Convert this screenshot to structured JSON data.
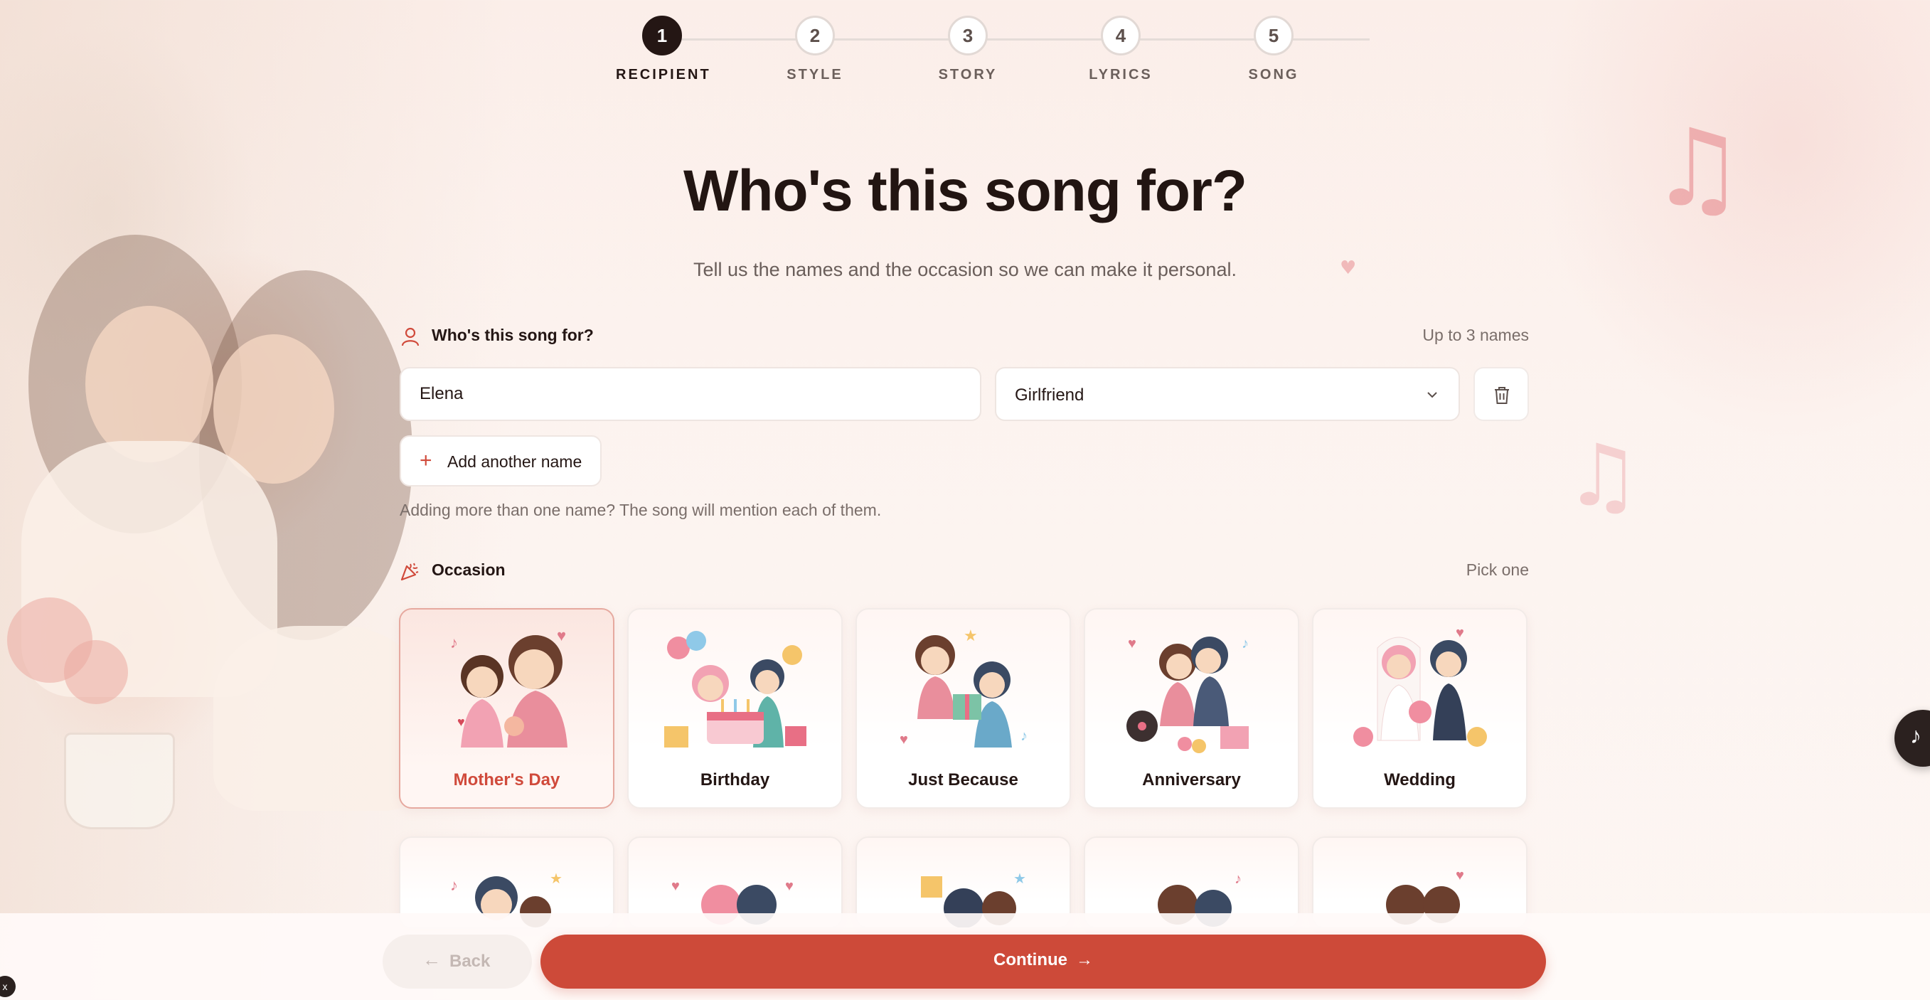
{
  "stepper": {
    "steps": [
      {
        "number": "1",
        "label": "RECIPIENT"
      },
      {
        "number": "2",
        "label": "STYLE"
      },
      {
        "number": "3",
        "label": "STORY"
      },
      {
        "number": "4",
        "label": "LYRICS"
      },
      {
        "number": "5",
        "label": "SONG"
      }
    ],
    "active_step": 1
  },
  "header": {
    "title": "Who's this song for?",
    "subtitle": "Tell us the names and the occasion so we can make it personal."
  },
  "recipients": {
    "section_label": "Who's this song for?",
    "section_hint": "Up to 3 names",
    "name_value": "Elena",
    "relation_value": "Girlfriend",
    "add_label": "Add another name",
    "helper_text": "Adding more than one name? The song will mention each of them."
  },
  "occasion": {
    "section_label": "Occasion",
    "section_hint": "Pick one",
    "selected": "Mother's Day",
    "cards": [
      {
        "label": "Mother's Day",
        "icon": "mother-child-illustration"
      },
      {
        "label": "Birthday",
        "icon": "birthday-cake-illustration"
      },
      {
        "label": "Just Because",
        "icon": "gift-couple-illustration"
      },
      {
        "label": "Anniversary",
        "icon": "couple-kiss-illustration"
      },
      {
        "label": "Wedding",
        "icon": "bride-groom-illustration"
      }
    ]
  },
  "footer": {
    "back_label": "Back",
    "continue_label": "Continue"
  },
  "colors": {
    "accent": "#cd4a39",
    "dark": "#241614",
    "background": "#fcf3ef"
  }
}
